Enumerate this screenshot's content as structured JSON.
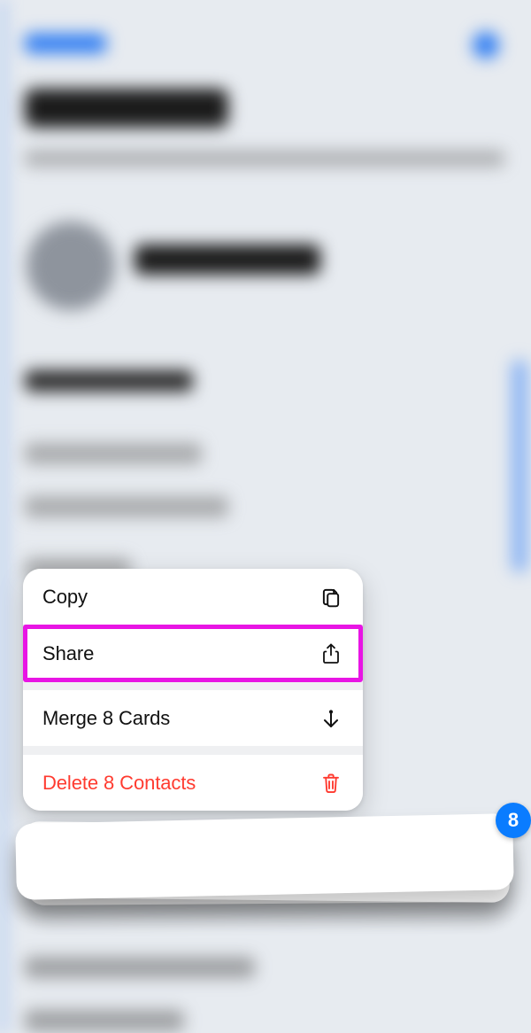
{
  "menu": {
    "items": [
      {
        "label": "Copy",
        "icon": "copy-icon"
      },
      {
        "label": "Share",
        "icon": "share-icon"
      },
      {
        "label": "Merge 8 Cards",
        "icon": "merge-icon"
      },
      {
        "label": "Delete 8 Contacts",
        "icon": "trash-icon",
        "destructive": true
      }
    ]
  },
  "stack_badge": "8",
  "colors": {
    "destructive": "#ff3b30",
    "badge": "#0a7cff",
    "highlight": "#e815e4"
  }
}
